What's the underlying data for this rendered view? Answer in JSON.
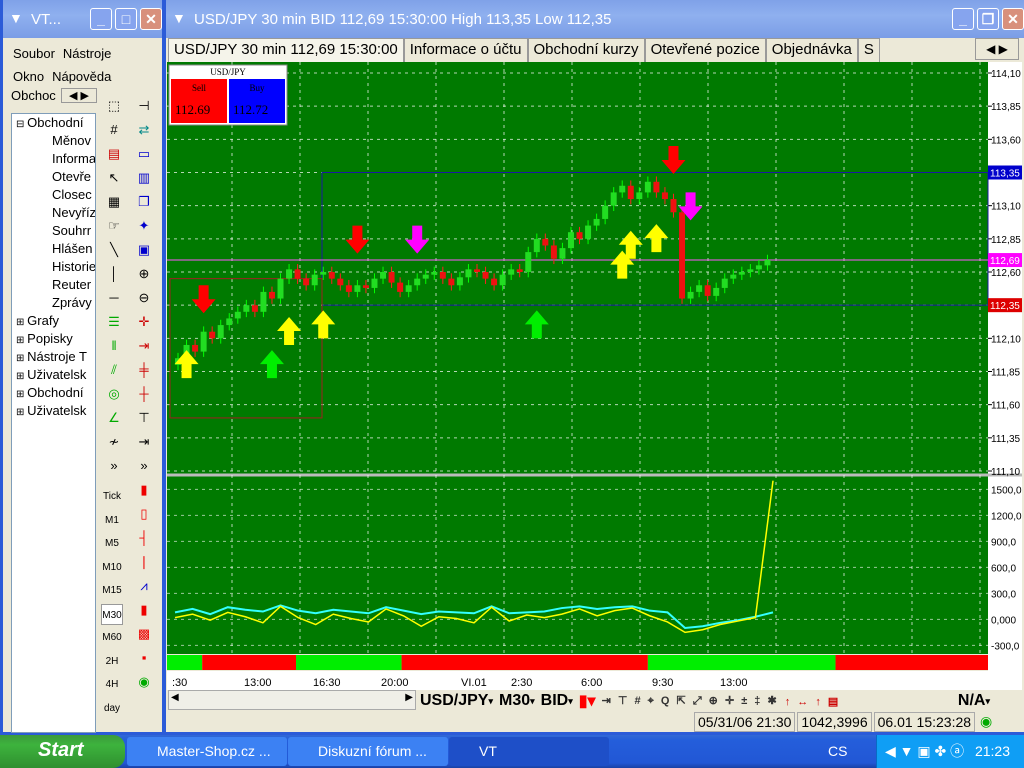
{
  "left_window": {
    "title": "VT...",
    "menu": [
      "Soubor",
      "Nástroje",
      "Okno",
      "Nápověda"
    ],
    "tab_label": "Obchoc",
    "tree": [
      {
        "t": "Obchodní",
        "lvl": 0,
        "exp": "−"
      },
      {
        "t": "Měnov",
        "lvl": 1
      },
      {
        "t": "Informa",
        "lvl": 1
      },
      {
        "t": "Otevře",
        "lvl": 1
      },
      {
        "t": "Closec",
        "lvl": 1
      },
      {
        "t": "Nevyříz",
        "lvl": 1
      },
      {
        "t": "Souhrr",
        "lvl": 1
      },
      {
        "t": "Hlášen",
        "lvl": 1
      },
      {
        "t": "Historie",
        "lvl": 1
      },
      {
        "t": "Reuter",
        "lvl": 1
      },
      {
        "t": "Zprávy",
        "lvl": 1
      },
      {
        "t": "Grafy",
        "lvl": 0,
        "exp": "+"
      },
      {
        "t": "Popisky",
        "lvl": 0,
        "exp": "+"
      },
      {
        "t": "Nástroje T",
        "lvl": 0,
        "exp": "+"
      },
      {
        "t": "Uživatelsk",
        "lvl": 0,
        "exp": "+"
      },
      {
        "t": "Obchodní",
        "lvl": 0,
        "exp": "+"
      },
      {
        "t": "Uživatelsk",
        "lvl": 0,
        "exp": "+"
      }
    ],
    "timeframes": [
      "Tick",
      "M1",
      "M5",
      "M10",
      "M15",
      "M30",
      "M60",
      "2H",
      "4H",
      "day"
    ],
    "selected_timeframe": "M30"
  },
  "main_window": {
    "title": "USD/JPY 30 min BID 112,69 15:30:00 High 113,35 Low 112,35",
    "tabs": [
      "USD/JPY 30 min 112,69 15:30:00",
      "Informace o účtu",
      "Obchodní kurzy",
      "Otevřené pozice",
      "Objednávka",
      "S"
    ]
  },
  "quote_box": {
    "symbol": "USD/JPY",
    "sell_label": "Sell",
    "buy_label": "Buy",
    "sell_price": "112.69",
    "buy_price": "112.72",
    "sell_color": "#ff0000",
    "buy_color": "#0000ff"
  },
  "price_axis": {
    "ticks": [
      "114,10",
      "113,85",
      "113,60",
      "113,35",
      "113,10",
      "112,85",
      "112,60",
      "112,35",
      "112,10",
      "111,85",
      "111,60",
      "111,35",
      "111,10"
    ],
    "markers": [
      {
        "label": "113,35",
        "value": 113.35,
        "color": "#0000cc"
      },
      {
        "label": "112,69",
        "value": 112.69,
        "color": "#ff00ff"
      },
      {
        "label": "112,35",
        "value": 112.35,
        "color": "#dd0000"
      }
    ]
  },
  "osc_axis": {
    "ticks": [
      "1500,0",
      "1200,0",
      "900,0",
      "600,0",
      "300,0",
      "0,000",
      "-300,0"
    ]
  },
  "time_axis": [
    ":30",
    "13:00",
    "16:30",
    "20:00",
    "VI.01",
    "2:30",
    "6:00",
    "9:30",
    "13:00"
  ],
  "chart_data": {
    "type": "candlestick",
    "open_first": 111.9,
    "closes": [
      111.95,
      112.05,
      112.0,
      112.15,
      112.1,
      112.2,
      112.25,
      112.3,
      112.35,
      112.3,
      112.45,
      112.4,
      112.55,
      112.62,
      112.55,
      112.5,
      112.58,
      112.6,
      112.55,
      112.5,
      112.45,
      112.5,
      112.48,
      112.55,
      112.6,
      112.52,
      112.45,
      112.5,
      112.55,
      112.58,
      112.6,
      112.55,
      112.5,
      112.56,
      112.62,
      112.6,
      112.55,
      112.5,
      112.58,
      112.62,
      112.6,
      112.75,
      112.85,
      112.8,
      112.7,
      112.78,
      112.9,
      112.85,
      112.95,
      113.0,
      113.1,
      113.2,
      113.25,
      113.15,
      113.2,
      113.28,
      113.2,
      113.15,
      113.05,
      112.4,
      112.45,
      112.5,
      112.42,
      112.48,
      112.55,
      112.58,
      112.6,
      112.62,
      112.65,
      112.69
    ],
    "ylim": [
      111.1,
      114.1
    ],
    "arrows": [
      {
        "i": 1,
        "p": 111.8,
        "dir": "up",
        "color": "#ffff00"
      },
      {
        "i": 3,
        "p": 112.5,
        "dir": "down",
        "color": "#ff0000"
      },
      {
        "i": 11,
        "p": 111.8,
        "dir": "up",
        "color": "#00ee00"
      },
      {
        "i": 13,
        "p": 112.05,
        "dir": "up",
        "color": "#ffff00"
      },
      {
        "i": 17,
        "p": 112.1,
        "dir": "up",
        "color": "#ffff00"
      },
      {
        "i": 21,
        "p": 112.95,
        "dir": "down",
        "color": "#ff0000"
      },
      {
        "i": 28,
        "p": 112.95,
        "dir": "down",
        "color": "#ff00ff"
      },
      {
        "i": 42,
        "p": 112.1,
        "dir": "up",
        "color": "#00ee00"
      },
      {
        "i": 52,
        "p": 112.55,
        "dir": "up",
        "color": "#ffff00"
      },
      {
        "i": 53,
        "p": 112.7,
        "dir": "up",
        "color": "#ffff00"
      },
      {
        "i": 56,
        "p": 112.75,
        "dir": "up",
        "color": "#ffff00"
      },
      {
        "i": 58,
        "p": 113.55,
        "dir": "down",
        "color": "#ff0000"
      },
      {
        "i": 60,
        "p": 113.2,
        "dir": "down",
        "color": "#ff00ff"
      }
    ],
    "osc_ylim": [
      -400,
      1700
    ],
    "osc_yellow": [
      20,
      60,
      -10,
      80,
      30,
      -40,
      150,
      20,
      -60,
      60,
      10,
      -30,
      120,
      40,
      -80,
      30,
      10,
      -40,
      140,
      -20,
      50,
      20,
      60,
      120,
      40,
      100,
      130,
      40,
      -30,
      -150,
      -120,
      -60,
      -20,
      20,
      1600
    ],
    "osc_cyan": [
      80,
      120,
      60,
      140,
      110,
      90,
      160,
      100,
      70,
      110,
      90,
      70,
      140,
      100,
      60,
      90,
      80,
      70,
      150,
      70,
      80,
      90,
      130,
      150,
      120,
      140,
      150,
      100,
      80,
      -100,
      -80,
      -40,
      -10,
      30,
      80
    ],
    "signal_bar": [
      {
        "color": "#00ee00",
        "n": 3
      },
      {
        "color": "#ff0000",
        "n": 8
      },
      {
        "color": "#00ee00",
        "n": 9
      },
      {
        "color": "#ff0000",
        "n": 21
      },
      {
        "color": "#00ee00",
        "n": 16
      },
      {
        "color": "#ff0000",
        "n": 13
      }
    ]
  },
  "bottom_toolbar": {
    "symbol": "USD/JPY",
    "timeframe": "M30",
    "side": "BID",
    "na": "N/A"
  },
  "status": {
    "datetime": "05/31/06 21:30",
    "value": "1042,3996",
    "clock": "06.01 15:23:28"
  },
  "taskbar": {
    "start": "Start",
    "items": [
      "Master-Shop.cz ...",
      "Diskuzní fórum ...",
      "VT"
    ],
    "lang": "CS",
    "time": "21:23"
  }
}
